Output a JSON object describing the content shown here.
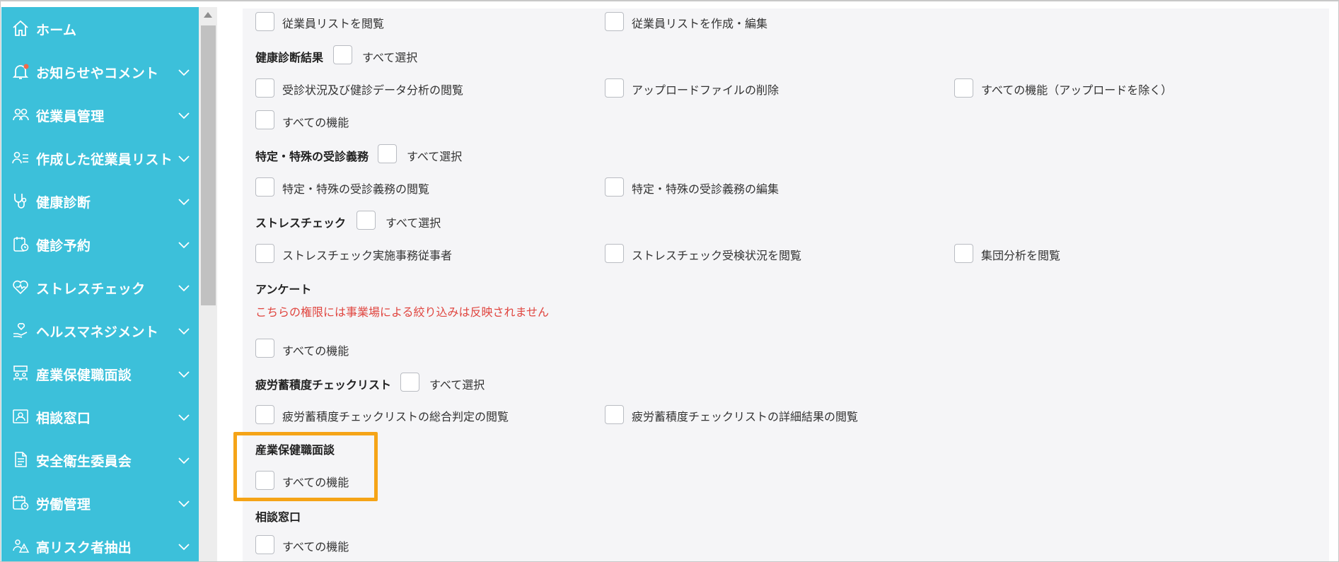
{
  "sidebar": {
    "items": [
      {
        "label": "ホーム",
        "icon": "home-icon",
        "has_chevron": false
      },
      {
        "label": "お知らせやコメント",
        "icon": "bell-icon",
        "has_chevron": true
      },
      {
        "label": "従業員管理",
        "icon": "people-icon",
        "has_chevron": true
      },
      {
        "label": "作成した従業員リスト",
        "icon": "user-list-icon",
        "has_chevron": true
      },
      {
        "label": "健康診断",
        "icon": "stethoscope-icon",
        "has_chevron": true
      },
      {
        "label": "健診予約",
        "icon": "calendar-clipboard-icon",
        "has_chevron": true
      },
      {
        "label": "ストレスチェック",
        "icon": "heart-icon",
        "has_chevron": true
      },
      {
        "label": "ヘルスマネジメント",
        "icon": "hand-heart-icon",
        "has_chevron": true
      },
      {
        "label": "産業保健職面談",
        "icon": "meeting-icon",
        "has_chevron": true
      },
      {
        "label": "相談窓口",
        "icon": "person-frame-icon",
        "has_chevron": true
      },
      {
        "label": "安全衛生委員会",
        "icon": "document-icon",
        "has_chevron": true
      },
      {
        "label": "労働管理",
        "icon": "calendar-clock-icon",
        "has_chevron": true
      },
      {
        "label": "高リスク者抽出",
        "icon": "people-warning-icon",
        "has_chevron": true
      }
    ]
  },
  "permissions": {
    "top_row": {
      "opt1": "従業員リストを閲覧",
      "opt2": "従業員リストを作成・編集"
    },
    "health_exam": {
      "title": "健康診断結果",
      "select_all": "すべて選択",
      "opt1": "受診状況及び健診データ分析の閲覧",
      "opt2": "アップロードファイルの削除",
      "opt3": "すべての機能（アップロードを除く）",
      "opt4": "すべての機能"
    },
    "special_exam": {
      "title": "特定・特殊の受診義務",
      "select_all": "すべて選択",
      "opt1": "特定・特殊の受診義務の閲覧",
      "opt2": "特定・特殊の受診義務の編集"
    },
    "stress_check": {
      "title": "ストレスチェック",
      "select_all": "すべて選択",
      "opt1": "ストレスチェック実施事務従事者",
      "opt2": "ストレスチェック受検状況を閲覧",
      "opt3": "集団分析を閲覧"
    },
    "survey": {
      "title": "アンケート",
      "notice": "こちらの権限には事業場による絞り込みは反映されません",
      "opt1": "すべての機能"
    },
    "fatigue": {
      "title": "疲労蓄積度チェックリスト",
      "select_all": "すべて選択",
      "opt1": "疲労蓄積度チェックリストの総合判定の閲覧",
      "opt2": "疲労蓄積度チェックリストの詳細結果の閲覧"
    },
    "occupational": {
      "title": "産業保健職面談",
      "opt1": "すべての機能"
    },
    "consult": {
      "title": "相談窓口",
      "opt1": "すべての機能"
    }
  },
  "colors": {
    "sidebar_bg": "#3cc0da",
    "highlight": "#f5a417",
    "warning_text": "#e0453f"
  }
}
